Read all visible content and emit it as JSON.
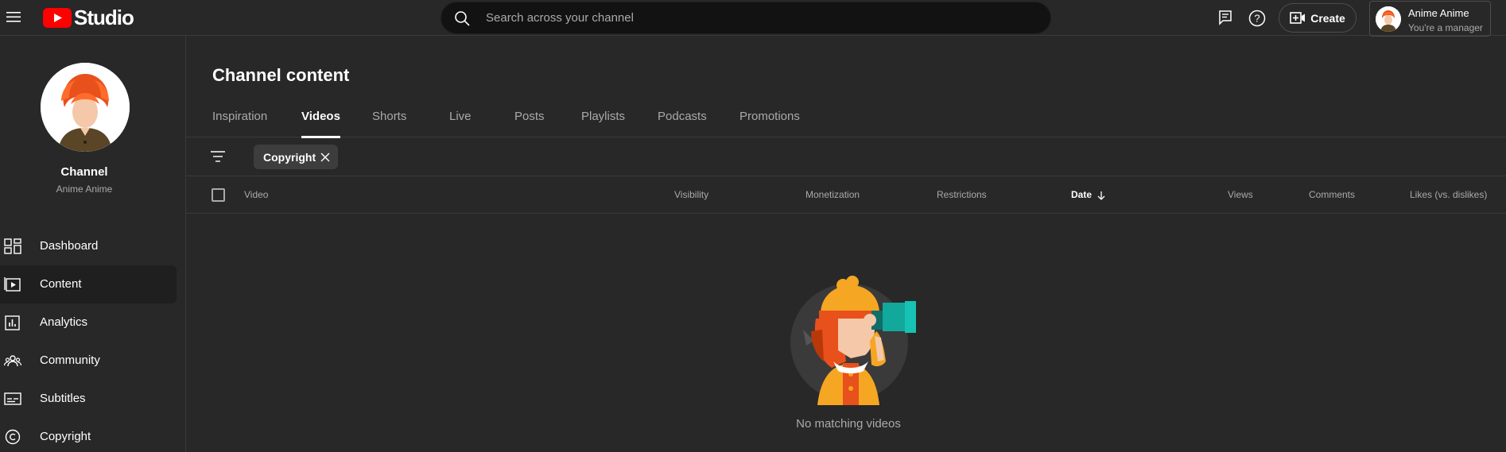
{
  "header": {
    "logo_text": "Studio",
    "search_placeholder": "Search across your channel",
    "create_label": "Create",
    "account": {
      "name": "Anime Anime",
      "role": "You're a manager"
    }
  },
  "sidebar": {
    "channel_title": "Channel",
    "channel_name": "Anime Anime",
    "items": [
      {
        "label": "Dashboard",
        "icon": "dashboard-icon"
      },
      {
        "label": "Content",
        "icon": "content-icon",
        "active": true
      },
      {
        "label": "Analytics",
        "icon": "analytics-icon"
      },
      {
        "label": "Community",
        "icon": "community-icon"
      },
      {
        "label": "Subtitles",
        "icon": "subtitles-icon"
      },
      {
        "label": "Copyright",
        "icon": "copyright-icon"
      }
    ]
  },
  "main": {
    "title": "Channel content",
    "tabs": [
      {
        "label": "Inspiration"
      },
      {
        "label": "Videos",
        "active": true
      },
      {
        "label": "Shorts"
      },
      {
        "label": "Live"
      },
      {
        "label": "Posts"
      },
      {
        "label": "Playlists"
      },
      {
        "label": "Podcasts"
      },
      {
        "label": "Promotions"
      }
    ],
    "filter_chip": "Copyright",
    "columns": [
      "Video",
      "Visibility",
      "Monetization",
      "Restrictions",
      "Date",
      "Views",
      "Comments",
      "Likes (vs. dislikes)"
    ],
    "sorted_column": "Date",
    "empty_message": "No matching videos"
  },
  "colors": {
    "background": "#282828",
    "accent_red": "#ff0000",
    "text_secondary": "#aaaaaa"
  }
}
